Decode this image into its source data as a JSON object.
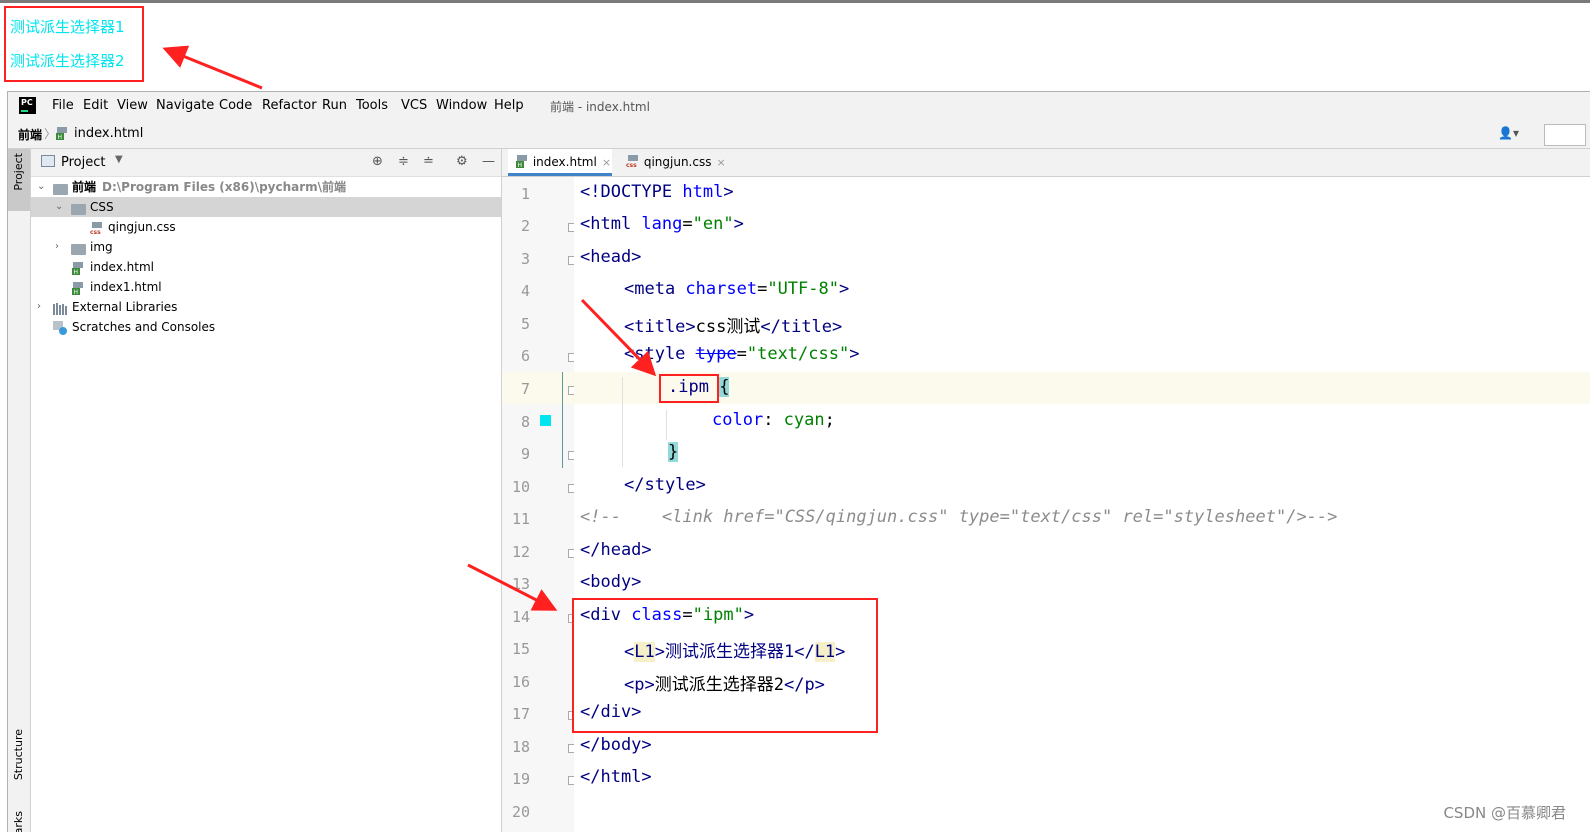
{
  "preview": {
    "lines": [
      "测试派生选择器1",
      "测试派生选择器2"
    ],
    "text_color": "#00e5ee"
  },
  "menubar": {
    "items": [
      "File",
      "Edit",
      "View",
      "Navigate",
      "Code",
      "Refactor",
      "Run",
      "Tools",
      "VCS",
      "Window",
      "Help"
    ],
    "window_title": "前端 - index.html"
  },
  "navbar": {
    "root": "前端",
    "file": "index.html"
  },
  "stripe": {
    "project": "Project",
    "structure": "Structure",
    "bookmarks": "Bookmarks"
  },
  "project_panel": {
    "title": "Project",
    "tree": [
      {
        "label": "前端",
        "path": "D:\\Program Files (x86)\\pycharm\\前端",
        "type": "folder"
      },
      {
        "label": "CSS",
        "type": "folder"
      },
      {
        "label": "qingjun.css",
        "type": "css"
      },
      {
        "label": "img",
        "type": "folder"
      },
      {
        "label": "index.html",
        "type": "html"
      },
      {
        "label": "index1.html",
        "type": "html"
      },
      {
        "label": "External Libraries",
        "type": "library"
      },
      {
        "label": "Scratches and Consoles",
        "type": "scratch"
      }
    ]
  },
  "editor": {
    "tabs": [
      {
        "label": "index.html",
        "active": true
      },
      {
        "label": "qingjun.css",
        "active": false
      }
    ],
    "line_numbers": [
      "1",
      "2",
      "3",
      "4",
      "5",
      "6",
      "7",
      "8",
      "9",
      "10",
      "11",
      "12",
      "13",
      "14",
      "15",
      "16",
      "17",
      "18",
      "19",
      "20"
    ],
    "code": {
      "l1a": "<!DOCTYPE ",
      "l1b": "html",
      "l1c": ">",
      "l2a": "<html ",
      "l2b": "lang",
      "l2c": "=",
      "l2d": "\"en\"",
      "l2e": ">",
      "l3": "<head>",
      "l4a": "<meta ",
      "l4b": "charset",
      "l4c": "=",
      "l4d": "\"UTF-8\"",
      "l4e": ">",
      "l5a": "<title>",
      "l5b": "css测试",
      "l5c": "</title>",
      "l6a": "<style ",
      "l6b": "type",
      "l6c": "=",
      "l6d": "\"text/css\"",
      "l6e": ">",
      "l7a": ".ipm",
      "l7b": "{",
      "l8a": "color",
      "l8b": ": ",
      "l8c": "cyan",
      "l8d": ";",
      "l9": "}",
      "l10": "</style>",
      "l11": "<!--    <link href=\"CSS/qingjun.css\" type=\"text/css\" rel=\"stylesheet\"/>-->",
      "l12": "</head>",
      "l13": "<body>",
      "l14a": "<div ",
      "l14b": "class",
      "l14c": "=",
      "l14d": "\"ipm\"",
      "l14e": ">",
      "l15a": "<",
      "l15b": "L1",
      "l15c": ">测试派生选择器1</",
      "l15d": "L1",
      "l15e": ">",
      "l16a": "<p>",
      "l16b": "测试派生选择器2",
      "l16c": "</p>",
      "l17": "</div>",
      "l18": "</body>",
      "l19": "</html>"
    }
  },
  "watermark": "CSDN @百慕卿君",
  "colors": {
    "highlight_red": "#ff2020",
    "cyan": "#00e5ee",
    "tag_blue": "#000080",
    "string_green": "#008000"
  }
}
